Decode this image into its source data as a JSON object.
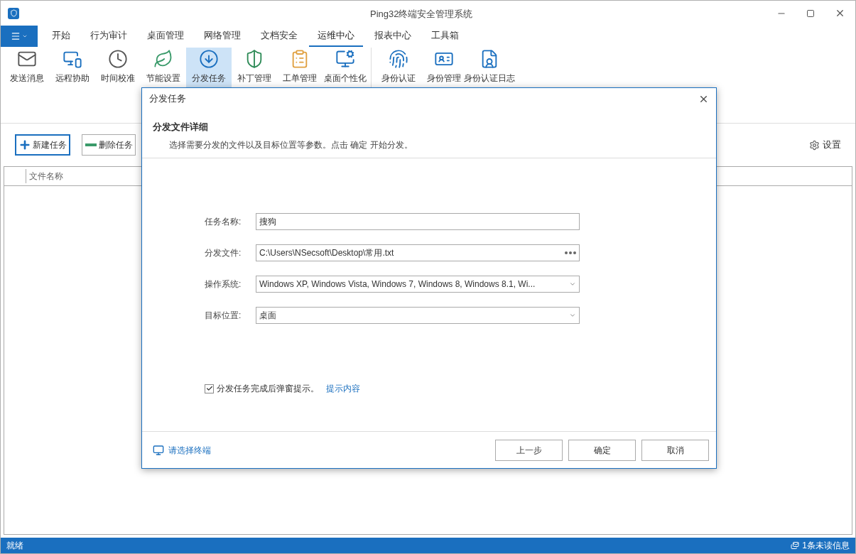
{
  "window": {
    "title": "Ping32终端安全管理系统"
  },
  "tabs": [
    {
      "label": "开始",
      "selected": false
    },
    {
      "label": "行为审计",
      "selected": false
    },
    {
      "label": "桌面管理",
      "selected": false
    },
    {
      "label": "网络管理",
      "selected": false
    },
    {
      "label": "文档安全",
      "selected": false
    },
    {
      "label": "运维中心",
      "selected": true
    },
    {
      "label": "报表中心",
      "selected": false
    },
    {
      "label": "工具箱",
      "selected": false
    }
  ],
  "ribbon": {
    "groups": [
      [
        {
          "label": "发送消息",
          "selected": false
        },
        {
          "label": "远程协助",
          "selected": false
        },
        {
          "label": "时间校准",
          "selected": false
        },
        {
          "label": "节能设置",
          "selected": false
        },
        {
          "label": "分发任务",
          "selected": true
        },
        {
          "label": "补丁管理",
          "selected": false
        },
        {
          "label": "工单管理",
          "selected": false
        },
        {
          "label": "桌面个性化",
          "selected": false
        }
      ],
      [
        {
          "label": "身份认证",
          "selected": false
        },
        {
          "label": "身份管理",
          "selected": false
        },
        {
          "label": "身份认证日志",
          "selected": false
        }
      ]
    ]
  },
  "toolbar": {
    "buttons": [
      {
        "label": "新建任务",
        "kind": "add",
        "focused": true
      },
      {
        "label": "删除任务",
        "kind": "remove",
        "focused": false
      }
    ],
    "settings": "设置"
  },
  "table": {
    "columns": [
      "文件名称"
    ]
  },
  "dialog": {
    "title": "分发任务",
    "heading": "分发文件详细",
    "description": "选择需要分发的文件以及目标位置等参数。点击 确定 开始分发。",
    "fields": [
      {
        "label": "任务名称:",
        "value": "搜狗",
        "kind": "text"
      },
      {
        "label": "分发文件:",
        "value": "C:\\Users\\NSecsoft\\Desktop\\常用.txt",
        "kind": "browse"
      },
      {
        "label": "操作系统:",
        "value": "Windows XP, Windows Vista, Windows 7, Windows 8, Windows 8.1, Wi...",
        "kind": "dropdown"
      },
      {
        "label": "目标位置:",
        "value": "桌面",
        "kind": "dropdown"
      }
    ],
    "checkbox": {
      "label": "分发任务完成后弹窗提示。",
      "checked": true
    },
    "link": "提示内容",
    "footer_link": "请选择终端",
    "buttons": [
      "上一步",
      "确定",
      "取消"
    ]
  },
  "status_bar": {
    "left": "就绪",
    "right": "1条未读信息"
  }
}
